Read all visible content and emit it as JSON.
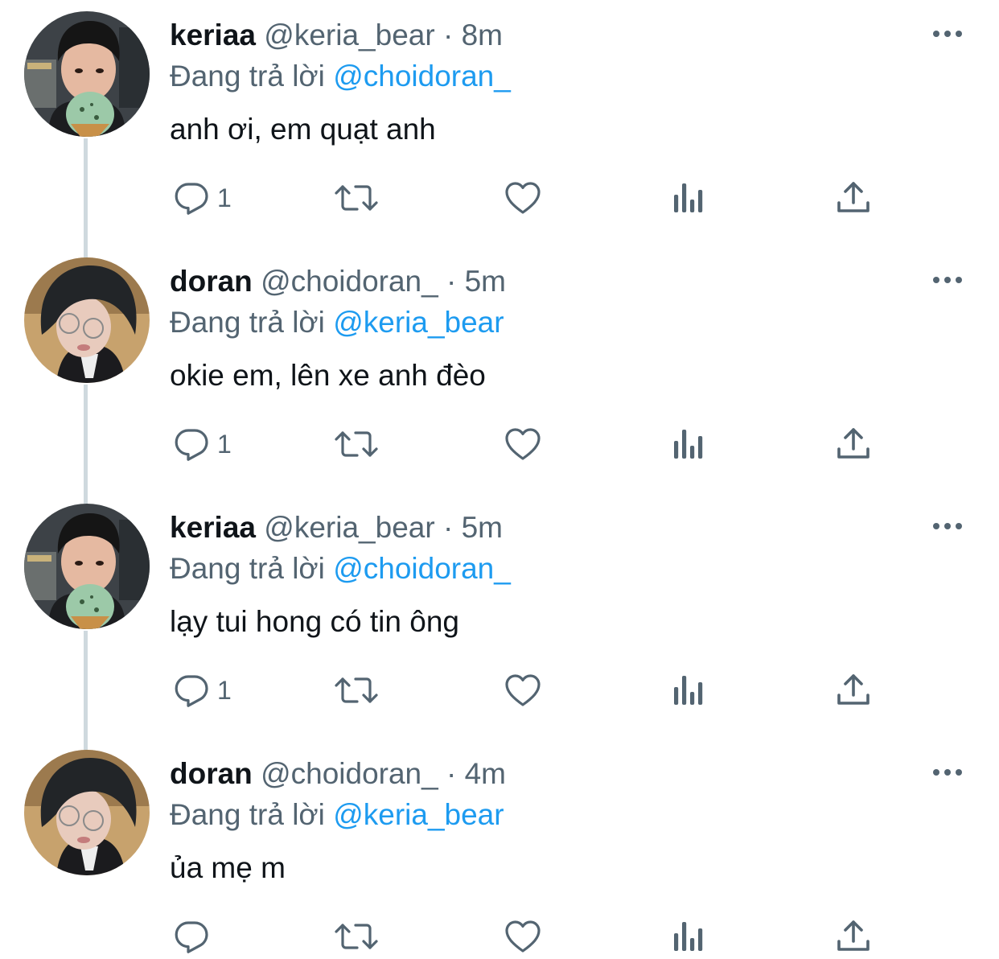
{
  "colors": {
    "accent": "#1d9bf0",
    "secondary_text": "#536471",
    "primary_text": "#0f1419",
    "thread_line": "#cfd9de"
  },
  "tweets": [
    {
      "name": "keriaa",
      "handle": "@keria_bear",
      "separator": "·",
      "time": "8m",
      "replying_prefix": "Đang trả lời",
      "replying_to": "@choidoran_",
      "text": "anh ơi, em quạt anh",
      "reply_count": "1",
      "avatar": "keria-avatar"
    },
    {
      "name": "doran",
      "handle": "@choidoran_",
      "separator": "·",
      "time": "5m",
      "replying_prefix": "Đang trả lời",
      "replying_to": "@keria_bear",
      "text": "okie em, lên xe anh đèo",
      "reply_count": "1",
      "avatar": "doran-avatar"
    },
    {
      "name": "keriaa",
      "handle": "@keria_bear",
      "separator": "·",
      "time": "5m",
      "replying_prefix": "Đang trả lời",
      "replying_to": "@choidoran_",
      "text": "lạy tui hong có tin ông",
      "reply_count": "1",
      "avatar": "keria-avatar"
    },
    {
      "name": "doran",
      "handle": "@choidoran_",
      "separator": "·",
      "time": "4m",
      "replying_prefix": "Đang trả lời",
      "replying_to": "@keria_bear",
      "text": "ủa mẹ m",
      "reply_count": "",
      "avatar": "doran-avatar"
    }
  ],
  "icons": {
    "reply": "reply-icon",
    "retweet": "retweet-icon",
    "like": "heart-icon",
    "views": "views-icon",
    "share": "share-icon",
    "more": "more-icon"
  }
}
